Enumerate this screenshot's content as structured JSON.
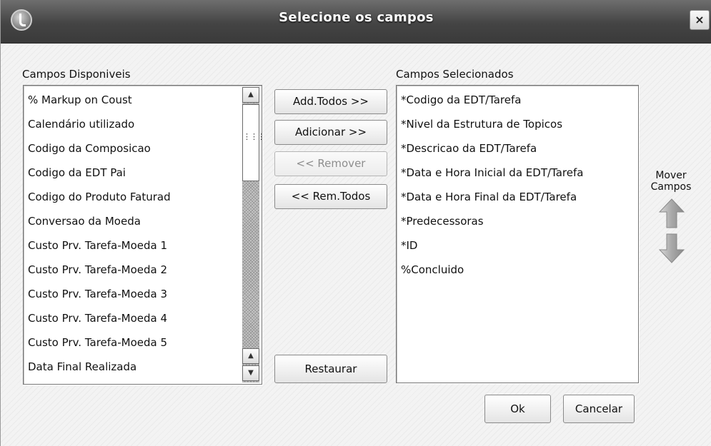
{
  "window": {
    "title": "Selecione os campos",
    "close_glyph": "×"
  },
  "available": {
    "label": "Campos Disponiveis",
    "items": [
      "% Markup on Coust",
      "Calendário utilizado",
      "Codigo da Composicao",
      "Codigo da EDT Pai",
      "Codigo do Produto Faturad",
      "Conversao da Moeda",
      "Custo Prv. Tarefa-Moeda 1",
      "Custo Prv. Tarefa-Moeda 2",
      "Custo Prv. Tarefa-Moeda 3",
      "Custo Prv. Tarefa-Moeda 4",
      "Custo Prv. Tarefa-Moeda 5",
      "Data Final Realizada"
    ]
  },
  "selected": {
    "label": "Campos Selecionados",
    "items": [
      "*Codigo da EDT/Tarefa",
      "*Nivel da Estrutura de Topicos",
      "*Descricao da EDT/Tarefa",
      "*Data e Hora Inicial da EDT/Tarefa",
      "*Data e Hora Final da EDT/Tarefa",
      "*Predecessoras",
      "*ID",
      "%Concluido"
    ]
  },
  "buttons": {
    "add_all": "Add.Todos >>",
    "add": "Adicionar >>",
    "remove": "<< Remover",
    "remove_all": "<< Rem.Todos",
    "restore": "Restaurar",
    "ok": "Ok",
    "cancel": "Cancelar"
  },
  "mover": {
    "line1": "Mover",
    "line2": "Campos"
  },
  "icons": {
    "app": "totvs-logo-icon",
    "up": "arrow-up-icon",
    "down": "arrow-down-icon",
    "scroll_up": "scroll-up-icon",
    "scroll_down": "scroll-down-icon"
  },
  "colors": {
    "titlebar": "#444444",
    "arrow": "#9a9a9a",
    "disabled_text": "#8e8e8e"
  }
}
